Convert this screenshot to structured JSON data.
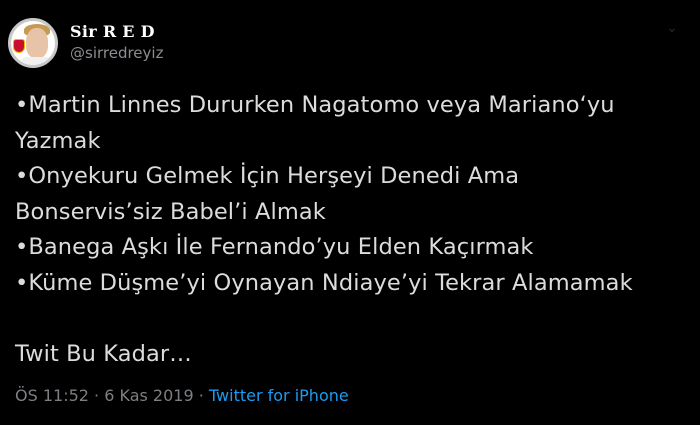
{
  "user": {
    "display_name": "Sir R E D",
    "handle": "@sirredreyiz"
  },
  "tweet": {
    "lines": [
      "•Martin Linnes Dururken Nagatomo veya Mariano‘yu",
      "Yazmak",
      "•Onyekuru Gelmek İçin Herşeyi Denedi Ama",
      "Bonservis’siz Babel’i Almak",
      "•Banega Aşkı İle Fernando’yu Elden Kaçırmak",
      "•Küme Düşme’yi Oynayan Ndiaye’yi Tekrar Alamamak"
    ],
    "closing": "Twit Bu Kadar…"
  },
  "meta": {
    "time": "ÖS 11:52",
    "separator": " · ",
    "date": "6 Kas 2019",
    "separator2": " · ",
    "source": "Twitter for iPhone"
  },
  "icons": {
    "caret": "chevron-down-icon",
    "avatar_badge": "galatasaray-badge"
  },
  "colors": {
    "background": "#000000",
    "text": "#dcdcdc",
    "muted": "#7c7f83",
    "link": "#1d9bf0"
  }
}
